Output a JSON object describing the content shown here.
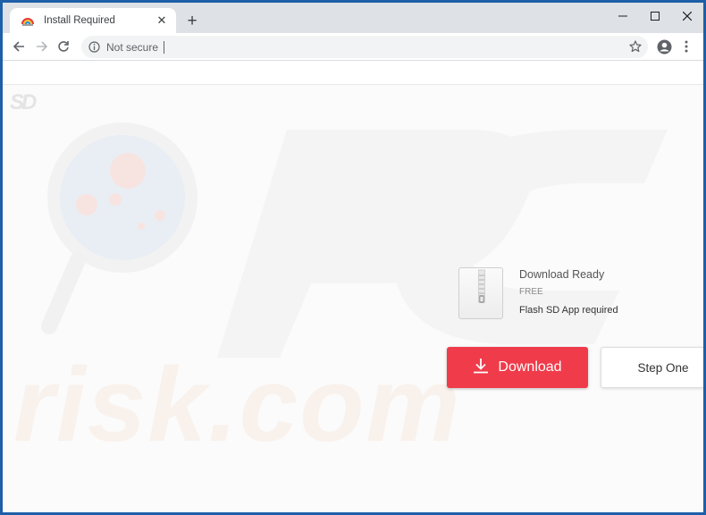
{
  "browser": {
    "tab": {
      "title": "Install Required",
      "close_glyph": "✕",
      "favicon": "rainbow-favicon-icon"
    },
    "new_tab_glyph": "+",
    "window_controls": [
      "minimize-icon",
      "maximize-icon",
      "close-icon"
    ],
    "toolbar": {
      "back": "arrow-left-icon",
      "forward": "arrow-right-icon",
      "reload": "reload-icon",
      "security_label": "Not secure",
      "url": "",
      "bookmark": "star-icon",
      "profile": "profile-icon",
      "menu": "kebab-menu-icon"
    }
  },
  "page": {
    "file_card": {
      "title": "Download Ready",
      "price": "FREE",
      "requirement": "Flash SD App required"
    },
    "download_button": {
      "label": "Download",
      "color": "#ef3b4a"
    },
    "step_button": {
      "label": "Step One"
    }
  },
  "colors": {
    "frame": "#1d5fa8",
    "titlebar": "#dee1e6",
    "omnibox": "#f1f3f4"
  }
}
